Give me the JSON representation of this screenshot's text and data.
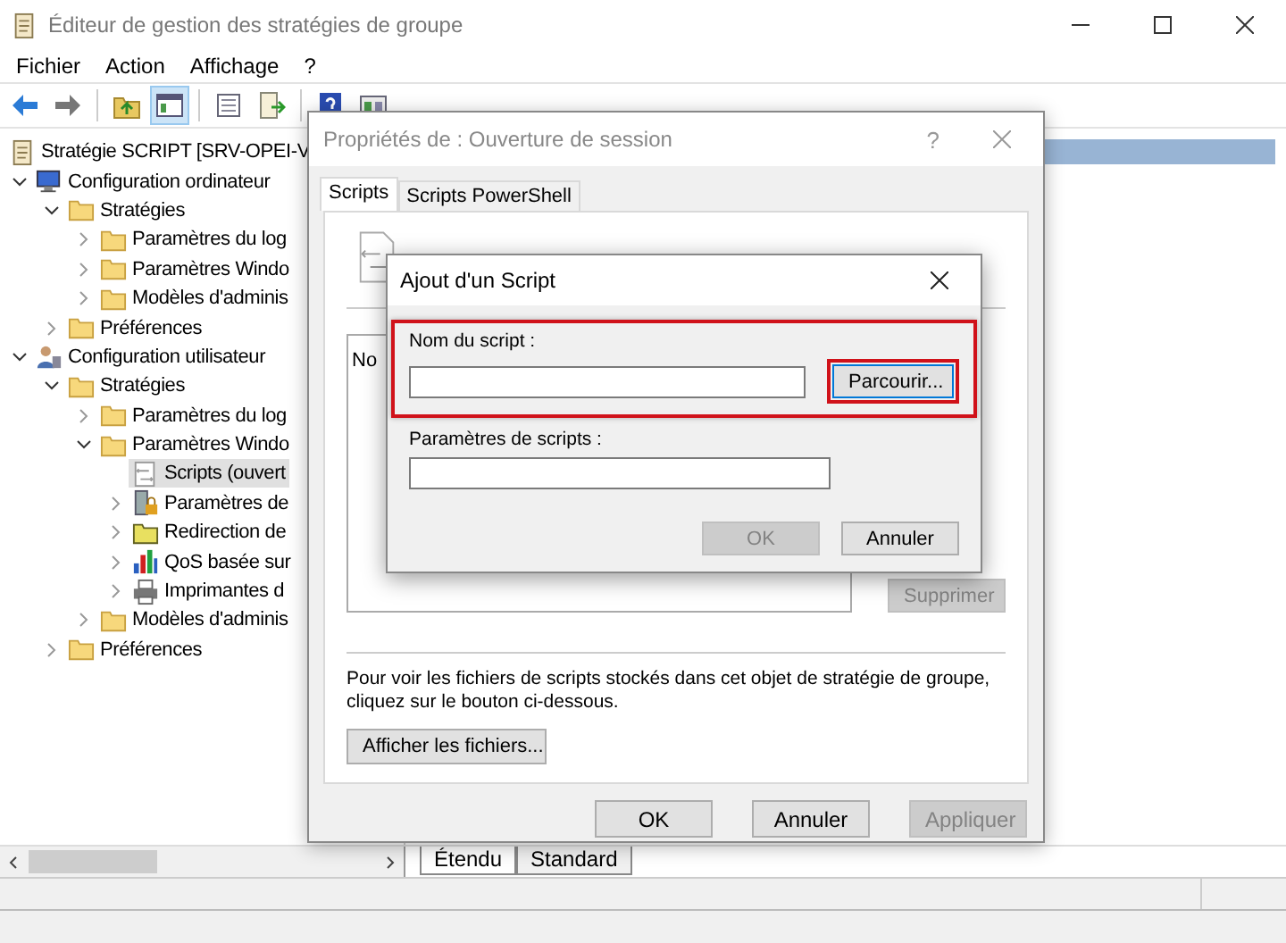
{
  "window": {
    "title": "Éditeur de gestion des stratégies de groupe"
  },
  "menu": [
    "Fichier",
    "Action",
    "Affichage",
    "?"
  ],
  "tree": {
    "root": {
      "label": "Stratégie SCRIPT [SRV-OPEI-V",
      "kind": "policy"
    },
    "children": [
      {
        "label": "Configuration ordinateur",
        "kind": "computer",
        "selected": false,
        "expanded": true,
        "children": [
          {
            "label": "Stratégies",
            "kind": "folder",
            "selected": false,
            "expanded": true,
            "children": [
              {
                "label": "Paramètres du log",
                "kind": "folder",
                "selected": false,
                "expanded": false
              },
              {
                "label": "Paramètres Windo",
                "kind": "folder",
                "selected": false,
                "expanded": false
              },
              {
                "label": "Modèles d'adminis",
                "kind": "folder",
                "selected": false,
                "expanded": false
              }
            ]
          },
          {
            "label": "Préférences",
            "kind": "folder",
            "selected": false,
            "expanded": false
          }
        ]
      },
      {
        "label": "Configuration utilisateur",
        "kind": "user",
        "selected": false,
        "expanded": true,
        "children": [
          {
            "label": "Stratégies",
            "kind": "folder",
            "selected": false,
            "expanded": true,
            "children": [
              {
                "label": "Paramètres du log",
                "kind": "folder",
                "selected": false,
                "expanded": false
              },
              {
                "label": "Paramètres Windo",
                "kind": "folder",
                "selected": false,
                "expanded": true,
                "children": [
                  {
                    "label": "Scripts (ouvert",
                    "kind": "script",
                    "selected": true
                  },
                  {
                    "label": "Paramètres de",
                    "kind": "security",
                    "selected": false,
                    "expanded": false
                  },
                  {
                    "label": "Redirection de",
                    "kind": "openfolder",
                    "selected": false,
                    "expanded": false
                  },
                  {
                    "label": "QoS basée sur",
                    "kind": "chart",
                    "selected": false,
                    "expanded": false
                  },
                  {
                    "label": "Imprimantes d",
                    "kind": "printer",
                    "selected": false,
                    "expanded": false
                  }
                ]
              },
              {
                "label": "Modèles d'adminis",
                "kind": "folder",
                "selected": false,
                "expanded": false
              }
            ]
          },
          {
            "label": "Préférences",
            "kind": "folder",
            "selected": false,
            "expanded": false
          }
        ]
      }
    ]
  },
  "view_tabs": [
    {
      "label": "Étendu",
      "selected": true
    },
    {
      "label": "Standard",
      "selected": false
    }
  ],
  "properties_dialog": {
    "title": "Propriétés de : Ouverture de session",
    "help": "?",
    "tabs": [
      {
        "label": "Scripts",
        "selected": true
      },
      {
        "label": "Scripts PowerShell",
        "selected": false
      }
    ],
    "list_header": "No",
    "side_buttons": [
      {
        "label": "Supprimer",
        "disabled": true
      }
    ],
    "note": "Pour voir les fichiers de scripts stockés dans cet objet de stratégie de groupe, cliquez sur le bouton ci-dessous.",
    "show_files_button": "Afficher les fichiers...",
    "buttons": [
      {
        "label": "OK",
        "disabled": false
      },
      {
        "label": "Annuler",
        "disabled": false
      },
      {
        "label": "Appliquer",
        "disabled": true
      }
    ]
  },
  "add_script_dialog": {
    "title": "Ajout d'un Script",
    "fields": [
      {
        "label": "Nom du script :",
        "highlighted": true,
        "button": {
          "label": "Parcourir...",
          "highlighted": true
        }
      },
      {
        "label": "Paramètres de scripts :",
        "highlighted": false
      }
    ],
    "buttons": [
      {
        "label": "OK",
        "disabled": true
      },
      {
        "label": "Annuler",
        "disabled": false
      }
    ]
  }
}
